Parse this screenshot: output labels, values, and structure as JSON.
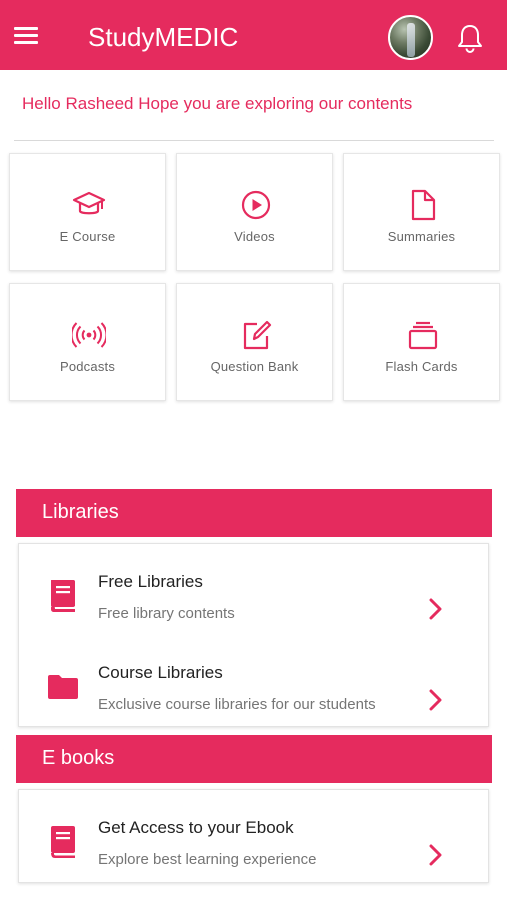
{
  "header": {
    "title": "StudyMEDIC",
    "accent": "#E52B5E",
    "menu_icon": "hamburger-icon",
    "notification_icon": "bell-icon"
  },
  "greeting": "Hello Rasheed Hope you are exploring our contents",
  "tiles": [
    {
      "label": "E Course",
      "icon": "graduation-cap-icon"
    },
    {
      "label": "Videos",
      "icon": "play-circle-icon"
    },
    {
      "label": "Summaries",
      "icon": "document-icon"
    },
    {
      "label": "Podcasts",
      "icon": "broadcast-icon"
    },
    {
      "label": "Question Bank",
      "icon": "edit-icon"
    },
    {
      "label": "Flash Cards",
      "icon": "cards-stack-icon"
    }
  ],
  "libraries": {
    "heading": "Libraries",
    "items": [
      {
        "title": "Free Libraries",
        "subtitle": "Free library contents",
        "icon": "book-icon"
      },
      {
        "title": "Course Libraries",
        "subtitle": "Exclusive course libraries for our students",
        "icon": "folder-icon"
      }
    ]
  },
  "ebooks": {
    "heading": "E books",
    "items": [
      {
        "title": "Get Access to your Ebook",
        "subtitle": "Explore best learning experience",
        "icon": "book-icon"
      }
    ]
  }
}
